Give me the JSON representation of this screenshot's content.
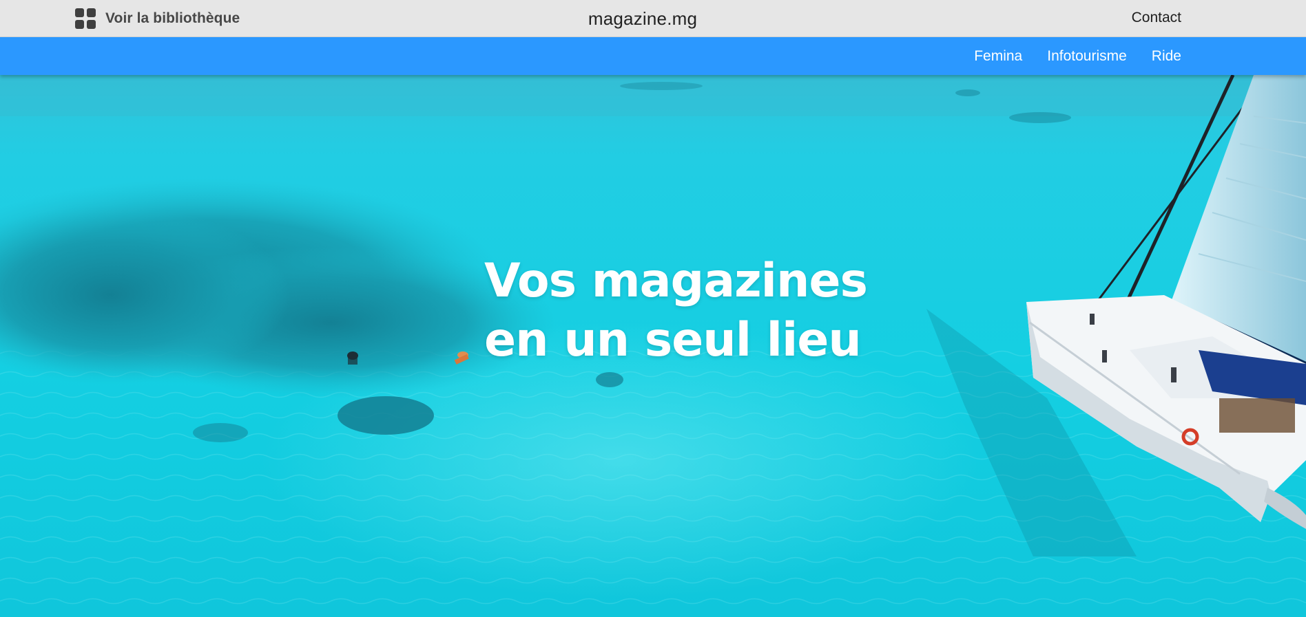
{
  "topbar": {
    "library_label": "Voir la bibliothèque",
    "library_icon": "grid-icon",
    "brand": "magazine.mg",
    "contact_label": "Contact"
  },
  "nav": {
    "items": [
      {
        "label": "Femina"
      },
      {
        "label": "Infotourisme"
      },
      {
        "label": "Ride"
      }
    ]
  },
  "hero": {
    "title_line1": "Vos magazines",
    "title_line2": "en un seul lieu"
  },
  "colors": {
    "topbar_bg": "#e6e6e6",
    "nav_bg": "#2b98ff",
    "hero_water": "#14c9dd",
    "text_light": "#ffffff"
  }
}
